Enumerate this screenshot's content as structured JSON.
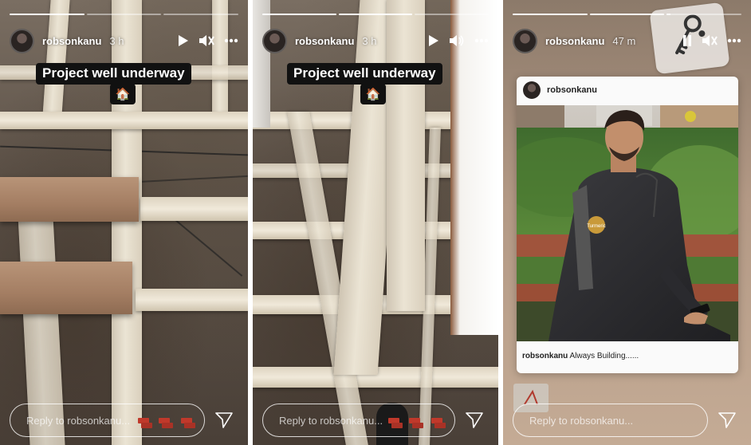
{
  "stories": [
    {
      "username": "robsonkanu",
      "time_ago": "3 h",
      "sticker_text": "Project well underway",
      "sticker_emoji": "🏠",
      "reply_placeholder": "Reply to robsonkanu...",
      "progress": [
        1.0,
        0.0,
        0.0
      ]
    },
    {
      "username": "robsonkanu",
      "time_ago": "3 h",
      "sticker_text": "Project well underway",
      "sticker_emoji": "🏠",
      "reply_placeholder": "Reply to robsonkanu...",
      "progress": [
        1.0,
        1.0,
        0.0
      ]
    },
    {
      "username": "robsonkanu",
      "time_ago": "47 m",
      "reply_placeholder": "Reply to robsonkanu...",
      "progress": [
        1.0,
        1.0,
        0.05
      ],
      "shared_post": {
        "username": "robsonkanu",
        "caption_user": "robsonkanu",
        "caption_text": "Always Building......",
        "badge_text": "Turmeric"
      }
    }
  ],
  "icons": {
    "play": "play-icon",
    "pause": "pause-icon",
    "mute": "speaker-muted-icon",
    "more": "more-options-icon",
    "send": "paper-plane-send-icon",
    "reaction": "bricks-sticker-icon"
  }
}
